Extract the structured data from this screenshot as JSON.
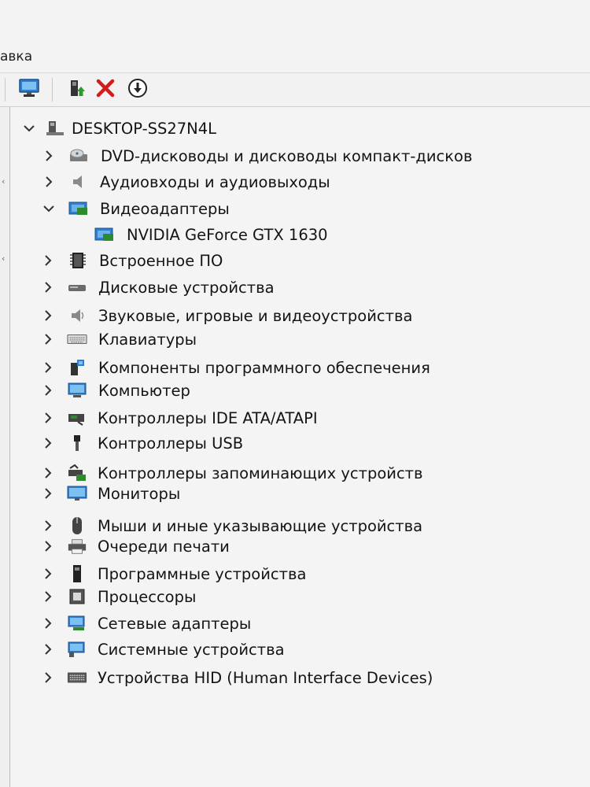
{
  "menubar": {
    "partial_menu": "авка"
  },
  "toolbar": {
    "buttons": [
      "computer-monitor-icon",
      "update-driver-icon",
      "uninstall-icon",
      "download-icon"
    ]
  },
  "tree": {
    "root": "DESKTOP-SS27N4L",
    "categories": [
      {
        "label": "DVD-дисководы и дисководы компакт-дисков",
        "icon": "dvd-drive-icon"
      },
      {
        "label": "Аудиовходы и аудиовыходы",
        "icon": "audio-io-icon"
      },
      {
        "label": "Видеоадаптеры",
        "icon": "display-adapter-icon",
        "expanded": true,
        "children": [
          {
            "label": "NVIDIA GeForce GTX 1630",
            "icon": "gpu-icon"
          }
        ]
      },
      {
        "label": "Встроенное ПО",
        "icon": "firmware-icon"
      },
      {
        "label": "Дисковые устройства",
        "icon": "disk-drive-icon"
      },
      {
        "label": "Звуковые, игровые и видеоустройства",
        "icon": "sound-icon"
      },
      {
        "label": "Клавиатуры",
        "icon": "keyboard-icon"
      },
      {
        "label": "Компоненты программного обеспечения",
        "icon": "software-component-icon"
      },
      {
        "label": "Компьютер",
        "icon": "computer-icon"
      },
      {
        "label": "Контроллеры IDE ATA/ATAPI",
        "icon": "ide-controller-icon"
      },
      {
        "label": "Контроллеры USB",
        "icon": "usb-icon"
      },
      {
        "label": "Контроллеры запоминающих устройств",
        "icon": "storage-controller-icon"
      },
      {
        "label": "Мониторы",
        "icon": "monitor-icon"
      },
      {
        "label": "Мыши и иные указывающие устройства",
        "icon": "mouse-icon"
      },
      {
        "label": "Очереди печати",
        "icon": "printer-icon"
      },
      {
        "label": "Программные устройства",
        "icon": "software-device-icon"
      },
      {
        "label": "Процессоры",
        "icon": "processor-icon"
      },
      {
        "label": "Сетевые адаптеры",
        "icon": "network-adapter-icon"
      },
      {
        "label": "Системные устройства",
        "icon": "system-device-icon"
      },
      {
        "label": "Устройства HID (Human Interface Devices)",
        "icon": "hid-icon"
      }
    ]
  },
  "colors": {
    "background": "#f5f4f4",
    "text": "#141414",
    "uninstall_red": "#d21c1c",
    "update_green": "#2e9a2e",
    "monitor_blue": "#2f7fd0"
  }
}
